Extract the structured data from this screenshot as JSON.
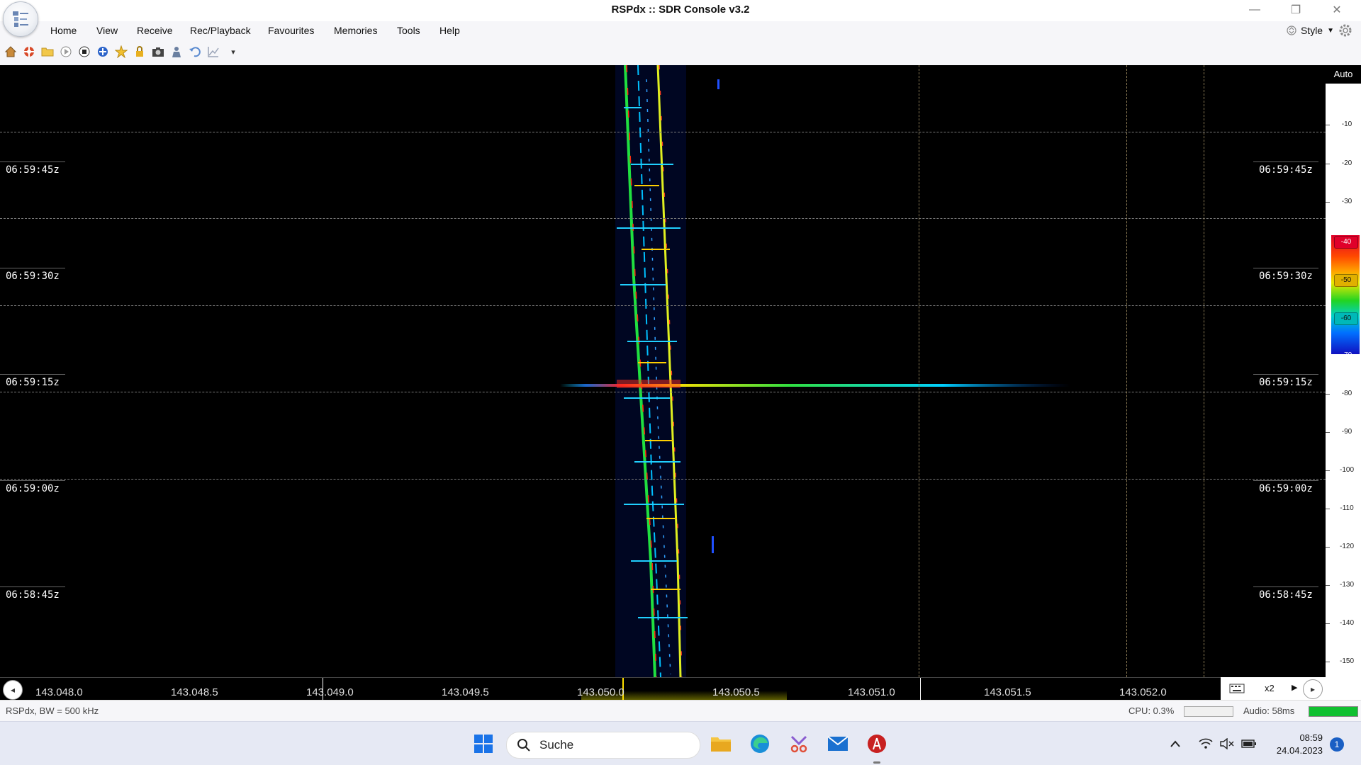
{
  "window": {
    "title": "RSPdx :: SDR Console v3.2",
    "controls": {
      "minimize": "—",
      "restore": "❐",
      "close": "✕"
    }
  },
  "menu": {
    "items": [
      "Home",
      "View",
      "Receive",
      "Rec/Playback",
      "Favourites",
      "Memories",
      "Tools",
      "Help"
    ],
    "style_label": "Style"
  },
  "toolbar": {
    "icons": [
      "home-icon",
      "lifebuoy-icon",
      "folder-icon",
      "play-icon",
      "stop-icon",
      "add-icon",
      "star-icon",
      "lock-icon",
      "camera-icon",
      "user-icon",
      "undo-icon",
      "chart-icon",
      "dropdown-icon"
    ]
  },
  "waterfall": {
    "timestamps": [
      "06:59:45z",
      "06:59:30z",
      "06:59:15z",
      "06:59:00z",
      "06:58:45z"
    ]
  },
  "dbscale": {
    "mode": "Auto",
    "labels": [
      "-10",
      "-20",
      "-30",
      "-40",
      "-50",
      "-60",
      "-70",
      "-80",
      "-90",
      "-100",
      "-110",
      "-120",
      "-130",
      "-140",
      "-150"
    ],
    "badges": [
      "-40",
      "-50",
      "-60"
    ],
    "badge_colors": [
      "#e0002a",
      "#e0b000",
      "#00b8b8"
    ]
  },
  "frequency": {
    "labels": [
      "143.048.0",
      "143.048.5",
      "143.049.0",
      "143.049.5",
      "143.050.0",
      "143.050.5",
      "143.051.0",
      "143.051.5",
      "143.052.0"
    ],
    "zoom": "x2"
  },
  "status": {
    "left": "RSPdx, BW = 500 kHz",
    "cpu": "CPU: 0.3%",
    "audio": "Audio: 58ms",
    "audio_level": 1.0
  },
  "taskbar": {
    "search_placeholder": "Suche",
    "time": "08:59",
    "date": "24.04.2023",
    "notification_count": "1"
  }
}
